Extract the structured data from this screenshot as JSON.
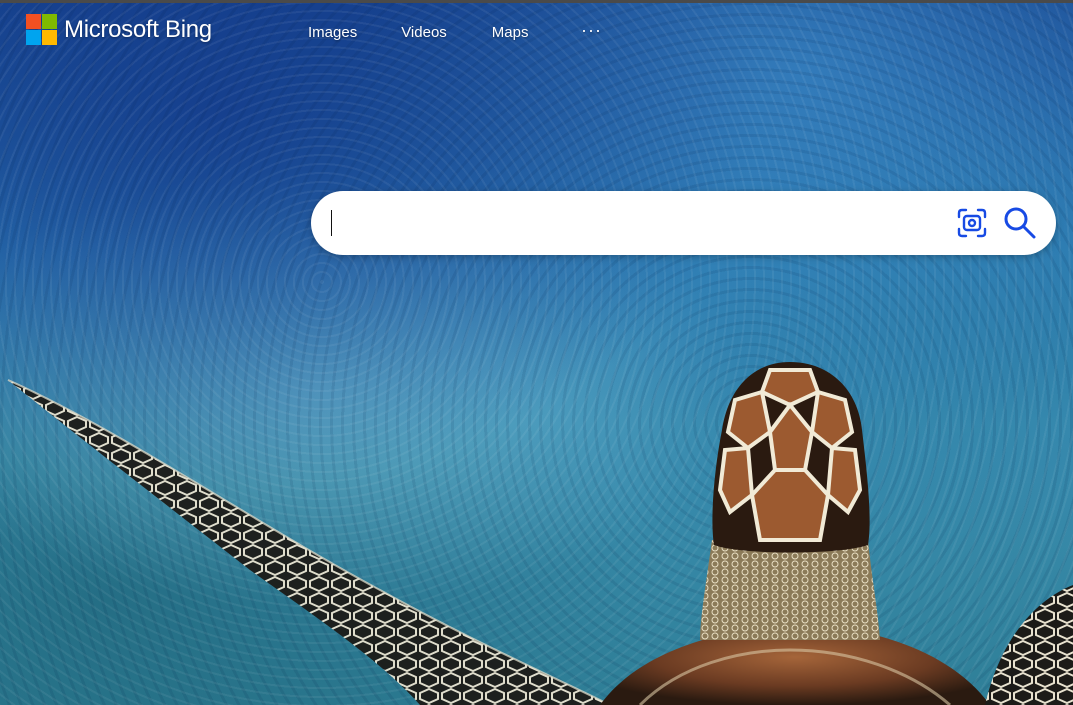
{
  "brand": {
    "name": "Microsoft Bing",
    "logo_colors": [
      "#f25022",
      "#7fba00",
      "#00a4ef",
      "#ffb900"
    ]
  },
  "nav": {
    "items": [
      {
        "label": "Images"
      },
      {
        "label": "Videos"
      },
      {
        "label": "Maps"
      }
    ],
    "more_label": "···"
  },
  "search": {
    "value": "",
    "placeholder": "",
    "visual_search_icon": "visual-search-icon",
    "search_icon": "search-icon",
    "icon_color": "#174ae4"
  },
  "background": {
    "subject": "sea-turtle-underwater-image"
  }
}
